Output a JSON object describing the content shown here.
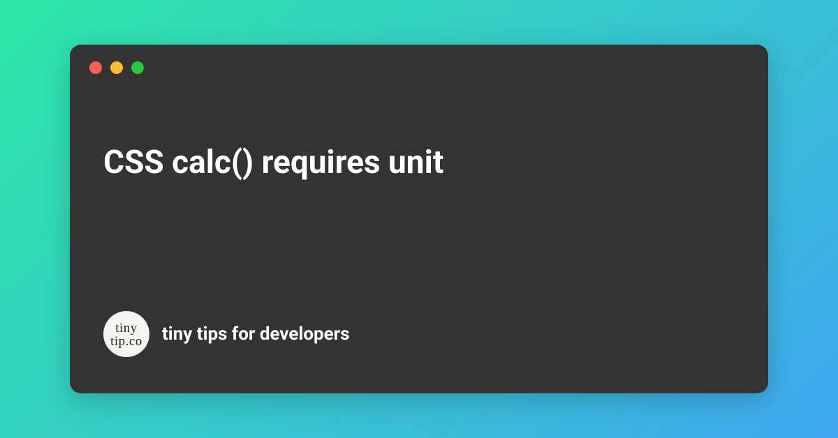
{
  "window": {
    "title": "CSS calc() requires unit"
  },
  "logo": {
    "line1": "tiny",
    "line2": "tip.co"
  },
  "tagline": "tiny tips for developers",
  "colors": {
    "gradient_start": "#2de8a7",
    "gradient_end": "#3fa8f0",
    "window_bg": "#333333",
    "traffic_red": "#ff5f56",
    "traffic_yellow": "#ffbd2e",
    "traffic_green": "#27c93f"
  }
}
